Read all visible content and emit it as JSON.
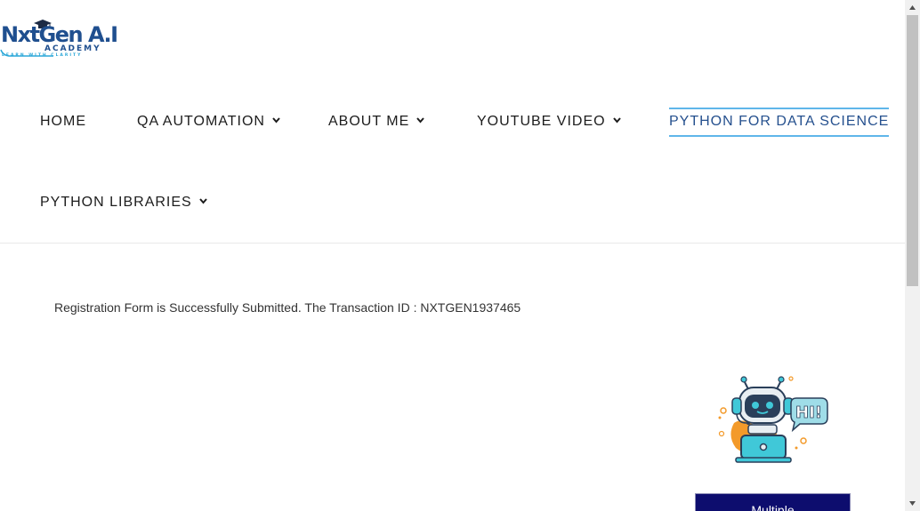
{
  "logo": {
    "main": "NxtGen A.I",
    "sub": "ACADEMY",
    "tagline": "LEARN WITH CLARITY",
    "icon": "graduation-cap-icon"
  },
  "nav": {
    "items": [
      {
        "label": "HOME",
        "has_dropdown": false
      },
      {
        "label": "QA AUTOMATION",
        "has_dropdown": true
      },
      {
        "label": "ABOUT ME",
        "has_dropdown": true
      },
      {
        "label": "YOUTUBE VIDEO",
        "has_dropdown": true
      },
      {
        "label": "PYTHON FOR DATA SCIENCE",
        "has_dropdown": false,
        "active": true
      },
      {
        "label": "PYTHON LIBRARIES",
        "has_dropdown": true
      }
    ]
  },
  "main": {
    "message": "Registration Form is Successfully Submitted. The Transaction ID : NXTGEN1937465"
  },
  "chatbot": {
    "greeting": "HI!",
    "icon": "chatbot-robot-icon"
  },
  "widget": {
    "button_label": "Multiple"
  },
  "colors": {
    "brand": "#1f4f8f",
    "accent": "#5fb6ea",
    "active_text": "#25508e",
    "button_bg": "#0d0d6e"
  }
}
